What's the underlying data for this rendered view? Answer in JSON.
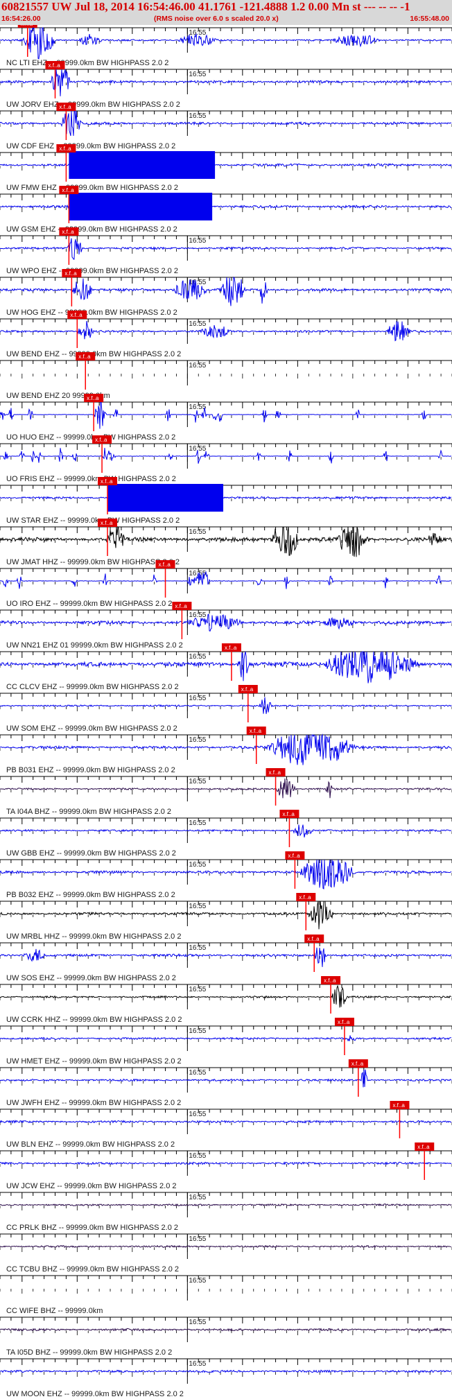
{
  "header": {
    "title": "60821557 UW Jul 18, 2014 16:54:46.00   41.1761 -121.4888  1.2 0.00 Mn st --- -- --  -1",
    "start_time": "16:54:26.00",
    "note": "(RMS noise over 6.0 s scaled 20.0 x)",
    "end_time": "16:55:48.00"
  },
  "colors": {
    "header_text": "#d40000",
    "header_bg": "#d8d8d8",
    "trace_blue": "#0000ee",
    "trace_black": "#000000",
    "trace_purple": "#2a0a4a",
    "pick_marker": "#ff0000",
    "pick_label_bg": "#dd0000"
  },
  "chart_data": {
    "type": "line",
    "time_axis": {
      "start": "16:54:26.00",
      "end": "16:55:48.00",
      "tick_label": "16:55"
    },
    "pick_label": "x.f..a",
    "traces": [
      {
        "label": "NC LTI EHZ -- 99999.0km BW  HIGHPASS  2.0  2",
        "color": "blue",
        "amplitude": 0.9,
        "pick_time_s": 5,
        "bursts": [
          [
            4,
            12,
            18,
            1.6
          ],
          [
            14,
            20,
            10,
            0.9
          ],
          [
            32,
            42,
            14,
            0.7
          ],
          [
            60,
            72,
            12,
            0.8
          ]
        ]
      },
      {
        "label": "UW JORV EHZ -- 99999.0km BW  HIGHPASS  2.0  2",
        "color": "blue",
        "amplitude": 1.4,
        "pick_time_s": 10,
        "bursts": [
          [
            9,
            14,
            16,
            1.8
          ]
        ]
      },
      {
        "label": "UW CDF EHZ -- 99999.0km BW  HIGHPASS  2.0  2",
        "color": "blue",
        "amplitude": 1.4,
        "pick_time_s": 12,
        "bursts": [
          [
            11,
            16,
            16,
            1.6
          ]
        ]
      },
      {
        "label": "UW FMW EHZ -- 99999.0km BW  HIGHPASS  2.0  2",
        "color": "blue",
        "amplitude": 1.4,
        "pick_time_s": 12,
        "saturated": [
          12.5,
          39
        ],
        "bursts": []
      },
      {
        "label": "UW GSM EHZ -- 99999.0km BW  HIGHPASS  2.0  2",
        "color": "blue",
        "amplitude": 1.4,
        "pick_time_s": 12.5,
        "saturated": [
          12.5,
          38.5
        ],
        "bursts": []
      },
      {
        "label": "UW WPO EHZ -- 99999.0km BW  HIGHPASS  2.0  2",
        "color": "blue",
        "amplitude": 1.2,
        "pick_time_s": 12.5,
        "bursts": [
          [
            12,
            16,
            12,
            1.6
          ]
        ]
      },
      {
        "label": "UW HOG EHZ -- 99999.0km BW  HIGHPASS  2.0  2",
        "color": "blue",
        "amplitude": 1.4,
        "pick_time_s": 13,
        "bursts": [
          [
            13,
            18,
            16,
            1.3
          ],
          [
            31,
            40,
            14,
            1.2
          ],
          [
            40,
            46,
            20,
            1.5
          ],
          [
            47,
            49,
            16,
            1.4
          ]
        ]
      },
      {
        "label": "UW BEND EHZ -- 99999.0km BW  HIGHPASS  2.0  2",
        "color": "blue",
        "amplitude": 1.2,
        "pick_time_s": 14,
        "bursts": [
          [
            14,
            18,
            12,
            1.3
          ],
          [
            36,
            44,
            10,
            1.0
          ],
          [
            70,
            76,
            14,
            1.2
          ]
        ]
      },
      {
        "label": "UW BEND EHZ 20 99999.0km",
        "color": "blue",
        "amplitude": 0,
        "pick_time_s": 15.5,
        "bursts": []
      },
      {
        "label": "UO HUO EHZ -- 99999.0km BW  HIGHPASS  2.0  2",
        "color": "blue",
        "amplitude": 0.25,
        "pick_time_s": 17,
        "spikes": [
          0.5,
          2,
          5.5,
          17.5,
          18.5,
          21,
          30.5,
          35.5,
          37,
          39,
          40,
          48,
          50.5,
          65,
          77
        ],
        "bursts": [
          [
            17,
            20,
            14,
            1.6
          ]
        ]
      },
      {
        "label": "UO FRIS EHZ -- 99999.0km BW  HIGHPASS  2.0  2",
        "color": "blue",
        "amplitude": 0.25,
        "pick_time_s": 18.5,
        "spikes": [
          1,
          4,
          6,
          7,
          11,
          13.5,
          19,
          20.5,
          31,
          36,
          37.5,
          47,
          52.5,
          60,
          70,
          80
        ],
        "bursts": [
          [
            18.5,
            21,
            10,
            1.4
          ]
        ]
      },
      {
        "label": "UW STAR EHZ -- 99999.0km BW  HIGHPASS  2.0  2",
        "color": "blue",
        "amplitude": 1.2,
        "pick_time_s": 19.5,
        "saturated": [
          19.5,
          40.5
        ],
        "bursts": []
      },
      {
        "label": "UW JMAT HHZ -- 99999.0km BW  HIGHPASS  2.0  2",
        "color": "black",
        "amplitude": 2.2,
        "pick_time_s": 19.5,
        "bursts": [
          [
            19,
            24,
            14,
            1.6
          ],
          [
            49,
            56,
            20,
            1.6
          ],
          [
            61,
            69,
            20,
            1.5
          ],
          [
            77,
            82,
            10,
            1.1
          ]
        ]
      },
      {
        "label": "UO IRO EHZ -- 99999.0km BW  HIGHPASS  2.0  2",
        "color": "blue",
        "amplitude": 0.3,
        "pick_time_s": 30,
        "spikes": [
          1,
          3.5,
          13.5,
          19,
          28,
          34.5,
          35.5,
          37,
          47,
          52,
          60,
          70,
          79.5
        ],
        "bursts": [
          [
            35,
            39,
            14,
            1.4
          ]
        ]
      },
      {
        "label": "UW NN21 EHZ 01 99999.0km BW  HIGHPASS  2.0  2",
        "color": "blue",
        "amplitude": 1.8,
        "pick_time_s": 33,
        "bursts": [
          [
            33,
            48,
            10,
            1.3
          ],
          [
            58,
            67,
            8,
            1.1
          ]
        ]
      },
      {
        "label": "CC CLCV EHZ -- 99999.0km BW  HIGHPASS  2.0  2",
        "color": "blue",
        "amplitude": 2.4,
        "pick_time_s": 42,
        "bursts": [
          [
            43,
            46,
            18,
            1.4
          ],
          [
            58,
            82,
            20,
            1.5
          ]
        ]
      },
      {
        "label": "UW SOM EHZ -- 99999.0km BW  HIGHPASS  2.0  2",
        "color": "blue",
        "amplitude": 0.9,
        "pick_time_s": 45,
        "bursts": [
          [
            47,
            50,
            12,
            1.2
          ]
        ]
      },
      {
        "label": "PB B031 EHZ -- 99999.0km BW  HIGHPASS  2.0  2",
        "color": "blue",
        "amplitude": 1.4,
        "pick_time_s": 46.5,
        "bursts": [
          [
            48,
            70,
            22,
            1.4
          ]
        ]
      },
      {
        "label": "TA I04A BHZ -- 99999.0km BW  HIGHPASS  2.0  2",
        "color": "purple",
        "amplitude": 1.0,
        "pick_time_s": 50,
        "bursts": [
          [
            50,
            55,
            14,
            1.3
          ],
          [
            59,
            61,
            14,
            1.2
          ]
        ]
      },
      {
        "label": "UW GBB EHZ -- 99999.0km BW  HIGHPASS  2.0  2",
        "color": "blue",
        "amplitude": 1.0,
        "pick_time_s": 52.5,
        "bursts": [
          [
            53,
            58,
            10,
            1.2
          ]
        ]
      },
      {
        "label": "PB B032 EHZ -- 99999.0km BW  HIGHPASS  2.0  2",
        "color": "blue",
        "amplitude": 1.4,
        "pick_time_s": 53.5,
        "bursts": [
          [
            54,
            68,
            20,
            1.4
          ]
        ]
      },
      {
        "label": "UW MRBL HHZ -- 99999.0km BW  HIGHPASS  2.0  2",
        "color": "black",
        "amplitude": 1.4,
        "pick_time_s": 55.5,
        "bursts": [
          [
            56,
            62,
            18,
            1.5
          ]
        ]
      },
      {
        "label": "UW SOS EHZ -- 99999.0km BW  HIGHPASS  2.0  2",
        "color": "blue",
        "amplitude": 1.4,
        "pick_time_s": 57,
        "bursts": [
          [
            4,
            10,
            8,
            1.2
          ],
          [
            57,
            60,
            16,
            1.3
          ]
        ]
      },
      {
        "label": "UW CCRK HHZ -- 99999.0km BW  HIGHPASS  2.0  2",
        "color": "black",
        "amplitude": 1.0,
        "pick_time_s": 60,
        "bursts": [
          [
            60,
            64,
            14,
            1.3
          ]
        ]
      },
      {
        "label": "UW HMET EHZ -- 99999.0km BW  HIGHPASS  2.0  2",
        "color": "blue",
        "amplitude": 1.1,
        "pick_time_s": 62.5,
        "bursts": [
          [
            63,
            65,
            10,
            1.3
          ]
        ]
      },
      {
        "label": "UW JWFH EHZ -- 99999.0km BW  HIGHPASS  2.0  2",
        "color": "blue",
        "amplitude": 1.1,
        "pick_time_s": 65,
        "bursts": [
          [
            65.5,
            67,
            20,
            1.3
          ]
        ]
      },
      {
        "label": "UW BLN EHZ -- 99999.0km BW  HIGHPASS  2.0  2",
        "color": "blue",
        "amplitude": 1.2,
        "pick_time_s": 72.5,
        "bursts": []
      },
      {
        "label": "UW JCW EHZ -- 99999.0km BW  HIGHPASS  2.0  2",
        "color": "blue",
        "amplitude": 1.2,
        "pick_time_s": 77,
        "bursts": []
      },
      {
        "label": "CC PRLK BHZ -- 99999.0km BW  HIGHPASS  2.0  2",
        "color": "purple",
        "amplitude": 1.0,
        "bursts": []
      },
      {
        "label": "CC TCBU BHZ -- 99999.0km BW  HIGHPASS  2.0  2",
        "color": "purple",
        "amplitude": 1.0,
        "bursts": []
      },
      {
        "label": "CC WIFE BHZ -- 99999.0km",
        "color": "purple",
        "amplitude": 0,
        "bursts": []
      },
      {
        "label": "TA I05D BHZ -- 99999.0km BW  HIGHPASS  2.0  2",
        "color": "purple",
        "amplitude": 1.2,
        "bursts": []
      },
      {
        "label": "UW MOON EHZ -- 99999.0km BW  HIGHPASS  2.0  2",
        "color": "blue",
        "amplitude": 1.2,
        "bursts": []
      }
    ]
  }
}
